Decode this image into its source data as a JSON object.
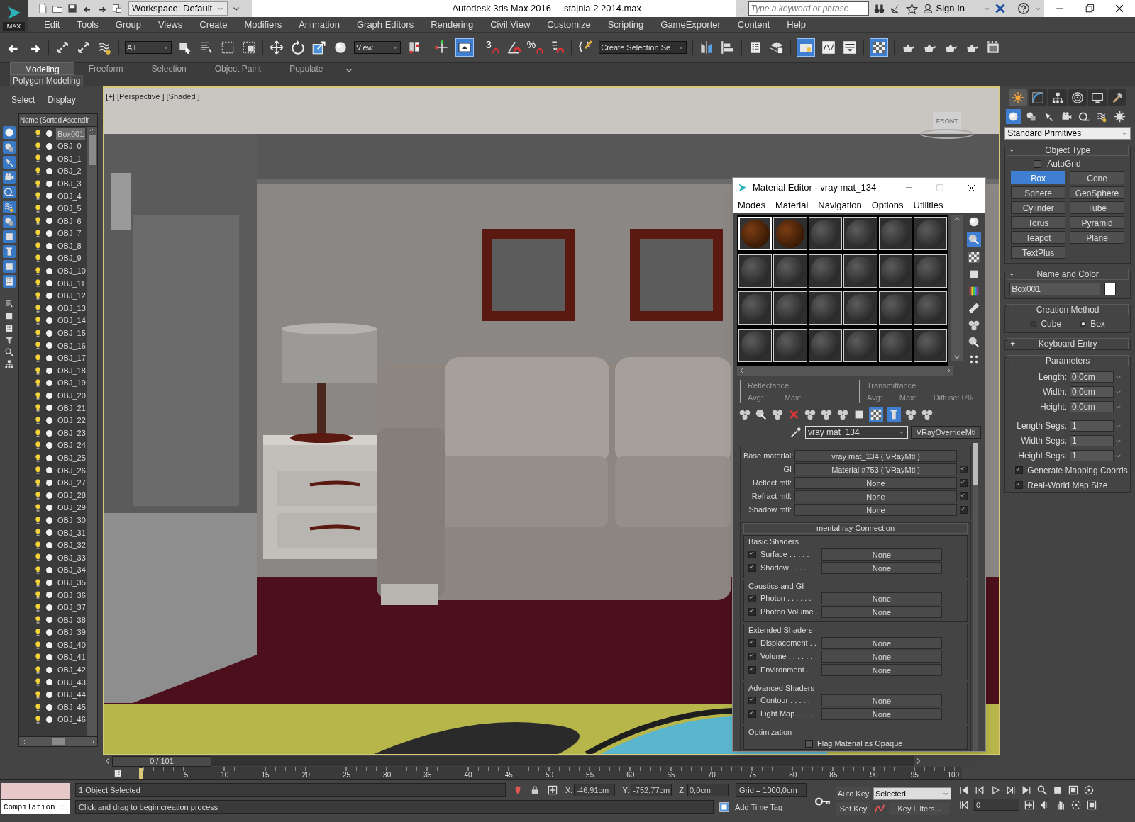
{
  "title_bar": {
    "logo": "MAX",
    "workspace": "Workspace: Default",
    "app": "Autodesk 3ds Max 2016",
    "file": "stajnia 2 2014.max",
    "search": {
      "placeholder": "Type a keyword or phrase"
    },
    "sign_in": "Sign In"
  },
  "menu": [
    "Edit",
    "Tools",
    "Group",
    "Views",
    "Create",
    "Modifiers",
    "Animation",
    "Graph Editors",
    "Rendering",
    "Civil View",
    "Customize",
    "Scripting",
    "GameExporter",
    "Content",
    "Help"
  ],
  "toolbar": {
    "selection_filter": "All",
    "reference_coord": "View",
    "snap_toggle": "3",
    "percent_snap": "%",
    "named_selection": "Create Selection Se"
  },
  "ribbon": {
    "tabs": [
      {
        "label": "Modeling",
        "selected": true
      },
      {
        "label": "Freeform",
        "selected": false
      },
      {
        "label": "Selection",
        "selected": false
      },
      {
        "label": "Object Paint",
        "selected": false
      },
      {
        "label": "Populate",
        "selected": false
      }
    ],
    "panel": "Polygon Modeling"
  },
  "scene_explorer": {
    "tabs": [
      "Select",
      "Display"
    ],
    "column": "Name (Sorted Ascendir",
    "items": [
      {
        "name": "Box001",
        "selected": true
      },
      {
        "name": "OBJ_0",
        "selected": false
      },
      {
        "name": "OBJ_1",
        "selected": false
      },
      {
        "name": "OBJ_2",
        "selected": false
      },
      {
        "name": "OBJ_3",
        "selected": false
      },
      {
        "name": "OBJ_4",
        "selected": false
      },
      {
        "name": "OBJ_5",
        "selected": false
      },
      {
        "name": "OBJ_6",
        "selected": false
      },
      {
        "name": "OBJ_7",
        "selected": false
      },
      {
        "name": "OBJ_8",
        "selected": false
      },
      {
        "name": "OBJ_9",
        "selected": false
      },
      {
        "name": "OBJ_10",
        "selected": false
      },
      {
        "name": "OBJ_11",
        "selected": false
      },
      {
        "name": "OBJ_12",
        "selected": false
      },
      {
        "name": "OBJ_13",
        "selected": false
      },
      {
        "name": "OBJ_14",
        "selected": false
      },
      {
        "name": "OBJ_15",
        "selected": false
      },
      {
        "name": "OBJ_16",
        "selected": false
      },
      {
        "name": "OBJ_17",
        "selected": false
      },
      {
        "name": "OBJ_18",
        "selected": false
      },
      {
        "name": "OBJ_19",
        "selected": false
      },
      {
        "name": "OBJ_20",
        "selected": false
      },
      {
        "name": "OBJ_21",
        "selected": false
      },
      {
        "name": "OBJ_22",
        "selected": false
      },
      {
        "name": "OBJ_23",
        "selected": false
      },
      {
        "name": "OBJ_24",
        "selected": false
      },
      {
        "name": "OBJ_25",
        "selected": false
      },
      {
        "name": "OBJ_26",
        "selected": false
      },
      {
        "name": "OBJ_27",
        "selected": false
      },
      {
        "name": "OBJ_28",
        "selected": false
      },
      {
        "name": "OBJ_29",
        "selected": false
      },
      {
        "name": "OBJ_30",
        "selected": false
      },
      {
        "name": "OBJ_31",
        "selected": false
      },
      {
        "name": "OBJ_32",
        "selected": false
      },
      {
        "name": "OBJ_33",
        "selected": false
      },
      {
        "name": "OBJ_34",
        "selected": false
      },
      {
        "name": "OBJ_35",
        "selected": false
      },
      {
        "name": "OBJ_36",
        "selected": false
      },
      {
        "name": "OBJ_37",
        "selected": false
      },
      {
        "name": "OBJ_38",
        "selected": false
      },
      {
        "name": "OBJ_39",
        "selected": false
      },
      {
        "name": "OBJ_40",
        "selected": false
      },
      {
        "name": "OBJ_41",
        "selected": false
      },
      {
        "name": "OBJ_42",
        "selected": false
      },
      {
        "name": "OBJ_43",
        "selected": false
      },
      {
        "name": "OBJ_44",
        "selected": false
      },
      {
        "name": "OBJ_45",
        "selected": false
      },
      {
        "name": "OBJ_46",
        "selected": false
      }
    ]
  },
  "viewport": {
    "labels": [
      "[+]",
      "[Perspective ]",
      "[Shaded ]"
    ],
    "viewcube": "FRONT"
  },
  "material_editor": {
    "title": "Material Editor - vray mat_134",
    "menu": [
      "Modes",
      "Material",
      "Navigation",
      "Options",
      "Utilities"
    ],
    "slots": [
      {
        "kind": "wood",
        "selected": true
      },
      {
        "kind": "wood",
        "selected": false
      },
      {
        "kind": "default",
        "selected": false
      },
      {
        "kind": "default",
        "selected": false
      },
      {
        "kind": "default",
        "selected": false
      },
      {
        "kind": "default",
        "selected": false
      },
      {
        "kind": "default",
        "selected": false
      },
      {
        "kind": "default",
        "selected": false
      },
      {
        "kind": "default",
        "selected": false
      },
      {
        "kind": "default",
        "selected": false
      },
      {
        "kind": "default",
        "selected": false
      },
      {
        "kind": "default",
        "selected": false
      },
      {
        "kind": "default",
        "selected": false
      },
      {
        "kind": "default",
        "selected": false
      },
      {
        "kind": "default",
        "selected": false
      },
      {
        "kind": "default",
        "selected": false
      },
      {
        "kind": "default",
        "selected": false
      },
      {
        "kind": "default",
        "selected": false
      },
      {
        "kind": "default",
        "selected": false
      },
      {
        "kind": "default",
        "selected": false
      },
      {
        "kind": "default",
        "selected": false
      },
      {
        "kind": "default",
        "selected": false
      },
      {
        "kind": "default",
        "selected": false
      },
      {
        "kind": "default",
        "selected": false
      }
    ],
    "reflectance": {
      "title": "Reflectance",
      "avg": "Avg:",
      "max": "Max:"
    },
    "transmittance": {
      "title": "Transmittance",
      "avg": "Avg:",
      "max": "Max:",
      "diffuse": "Diffuse:",
      "diffuse_value": "0%"
    },
    "material_name": "vray mat_134",
    "material_type": "VRayOverrideMtl",
    "params": [
      {
        "label": "Base material:",
        "value": "vray mat_134  ( VRayMtl )"
      },
      {
        "label": "GI",
        "value": "Material #753  ( VRayMtl )",
        "checked": true
      },
      {
        "label": "Reflect mtl:",
        "value": "None",
        "checked": true
      },
      {
        "label": "Refract mtl:",
        "value": "None",
        "checked": true
      },
      {
        "label": "Shadow mtl:",
        "value": "None",
        "checked": true
      }
    ],
    "mental_ray": {
      "sign": "-",
      "title": "mental ray Connection",
      "groups": [
        {
          "title": "Basic Shaders",
          "rows": [
            {
              "label": "Surface . . . . .",
              "value": "None",
              "checked": true
            },
            {
              "label": "Shadow . . . . .",
              "value": "None",
              "checked": true
            }
          ]
        },
        {
          "title": "Caustics and GI",
          "rows": [
            {
              "label": "Photon . . . . . .",
              "value": "None",
              "checked": true
            },
            {
              "label": "Photon Volume .",
              "value": "None",
              "checked": true
            }
          ]
        },
        {
          "title": "Extended Shaders",
          "rows": [
            {
              "label": "Displacement . .",
              "value": "None",
              "checked": true
            },
            {
              "label": "Volume . . . . . .",
              "value": "None",
              "checked": true
            },
            {
              "label": "Environment . .",
              "value": "None",
              "checked": true
            }
          ]
        },
        {
          "title": "Advanced Shaders",
          "rows": [
            {
              "label": "Contour . . . . .",
              "value": "None",
              "checked": true
            },
            {
              "label": "Light Map . . . .",
              "value": "None",
              "checked": true
            }
          ]
        }
      ],
      "optimization": {
        "title": "Optimization",
        "label": "Flag Material as Opaque",
        "checked": false
      }
    }
  },
  "command_panel": {
    "tabs": [
      {
        "selected": true
      },
      {
        "selected": false
      },
      {
        "selected": false
      },
      {
        "selected": false
      },
      {
        "selected": false
      },
      {
        "selected": false
      }
    ],
    "categories": [
      {
        "selected": true
      },
      {
        "selected": false
      },
      {
        "selected": false
      },
      {
        "selected": false
      },
      {
        "selected": false
      },
      {
        "selected": false
      },
      {
        "selected": false
      }
    ],
    "dropdown": "Standard Primitives",
    "object_type": {
      "sign": "-",
      "title": "Object Type",
      "autogrid": {
        "label": "AutoGrid",
        "checked": false
      },
      "buttons": [
        {
          "label": "Box",
          "selected": true
        },
        {
          "label": "Cone",
          "selected": false
        },
        {
          "label": "Sphere",
          "selected": false
        },
        {
          "label": "GeoSphere",
          "selected": false
        },
        {
          "label": "Cylinder",
          "selected": false
        },
        {
          "label": "Tube",
          "selected": false
        },
        {
          "label": "Torus",
          "selected": false
        },
        {
          "label": "Pyramid",
          "selected": false
        },
        {
          "label": "Teapot",
          "selected": false
        },
        {
          "label": "Plane",
          "selected": false
        },
        {
          "label": "TextPlus",
          "selected": false
        }
      ]
    },
    "name_and_color": {
      "sign": "-",
      "title": "Name and Color",
      "name": "Box001",
      "color": "#ffffff"
    },
    "creation_method": {
      "sign": "-",
      "title": "Creation Method",
      "options": [
        {
          "label": "Cube",
          "selected": false
        },
        {
          "label": "Box",
          "selected": true
        }
      ]
    },
    "keyboard_entry": {
      "sign": "+",
      "title": "Keyboard Entry"
    },
    "parameters": {
      "sign": "-",
      "title": "Parameters",
      "fields": [
        {
          "label": "Length:",
          "value": "0,0cm"
        },
        {
          "label": "Width:",
          "value": "0,0cm"
        },
        {
          "label": "Height:",
          "value": "0,0cm"
        }
      ],
      "segs": [
        {
          "label": "Length Segs:",
          "value": "1"
        },
        {
          "label": "Width Segs:",
          "value": "1"
        },
        {
          "label": "Height Segs:",
          "value": "1"
        }
      ],
      "options": [
        {
          "label": "Generate Mapping Coords.",
          "checked": true
        },
        {
          "label": "Real-World Map Size",
          "checked": true
        }
      ]
    }
  },
  "timeline": {
    "frame": "0 / 101",
    "ticks": [
      "5",
      "10",
      "15",
      "20",
      "25",
      "30",
      "35",
      "40",
      "45",
      "50",
      "55",
      "60",
      "65",
      "70",
      "75",
      "80",
      "85",
      "90",
      "95",
      "100"
    ]
  },
  "status": {
    "listener": "Compilation :",
    "selected_count": "1 Object Selected",
    "prompt": "Click and drag to begin creation process",
    "coords": [
      {
        "axis": "X:",
        "value": "-46,91cm"
      },
      {
        "axis": "Y:",
        "value": "-752,77cm"
      },
      {
        "axis": "Z:",
        "value": "0,0cm"
      }
    ],
    "grid": "Grid = 1000,0cm",
    "add_time_tag": "Add Time Tag",
    "auto_key": "Auto Key",
    "key_mode": "Selected",
    "set_key": "Set Key",
    "key_filters": "Key Filters...",
    "current_frame": "0"
  }
}
